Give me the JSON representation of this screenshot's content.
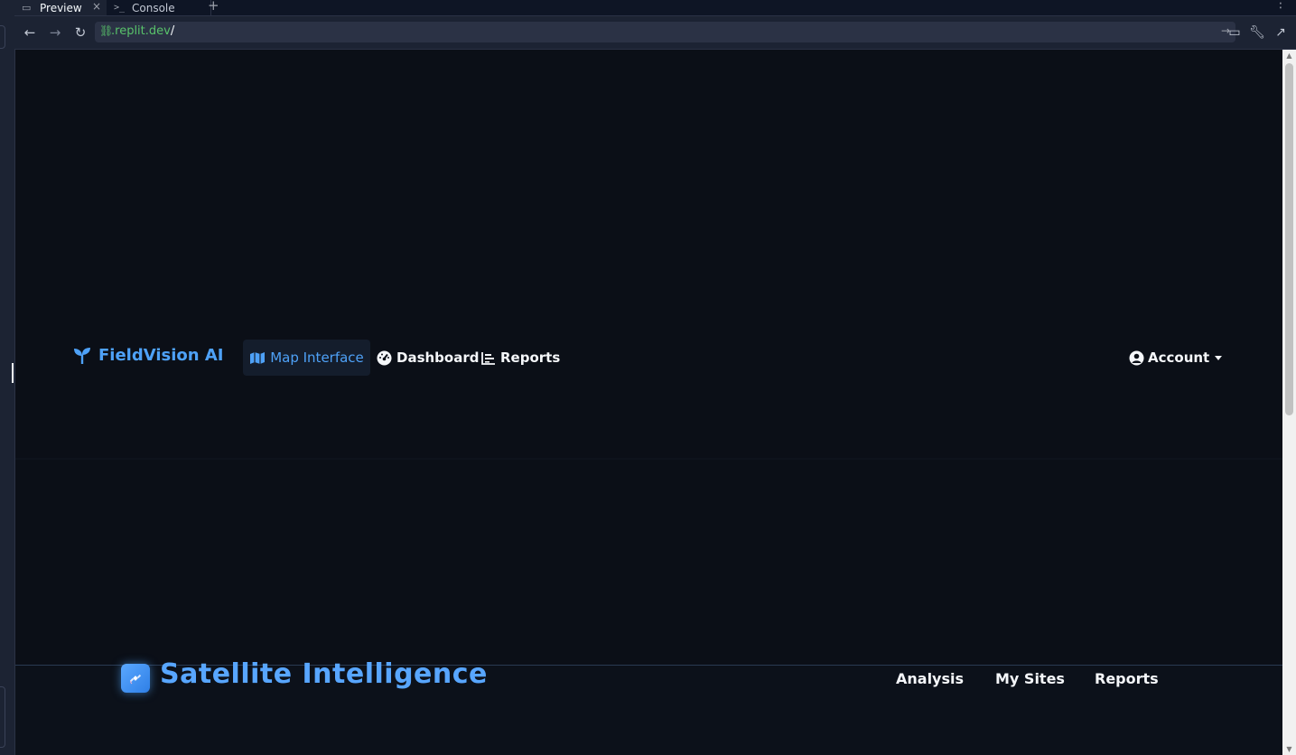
{
  "ide": {
    "tabs": [
      {
        "label": "Preview",
        "icon": "monitor-icon",
        "close": "×"
      },
      {
        "label": "Console",
        "icon": "terminal-icon"
      }
    ],
    "new_tab": "+",
    "menu": "⋮",
    "url": {
      "domain": ".replit.dev",
      "path": "/"
    }
  },
  "app": {
    "brand": "FieldVision AI",
    "brand_icon": "seedling-icon",
    "nav": [
      {
        "label": "Map Interface",
        "icon": "map-icon",
        "active": true
      },
      {
        "label": "Dashboard",
        "icon": "gauge-icon"
      },
      {
        "label": "Reports",
        "icon": "bar-chart-icon"
      }
    ],
    "account": {
      "label": "Account",
      "icon": "user-circle-icon"
    },
    "accent": "#4ea1f7"
  },
  "sub": {
    "title": "Satellite Intelligence",
    "logo_icon": "satellite-icon",
    "links": [
      "Analysis",
      "My Sites",
      "Reports"
    ]
  }
}
